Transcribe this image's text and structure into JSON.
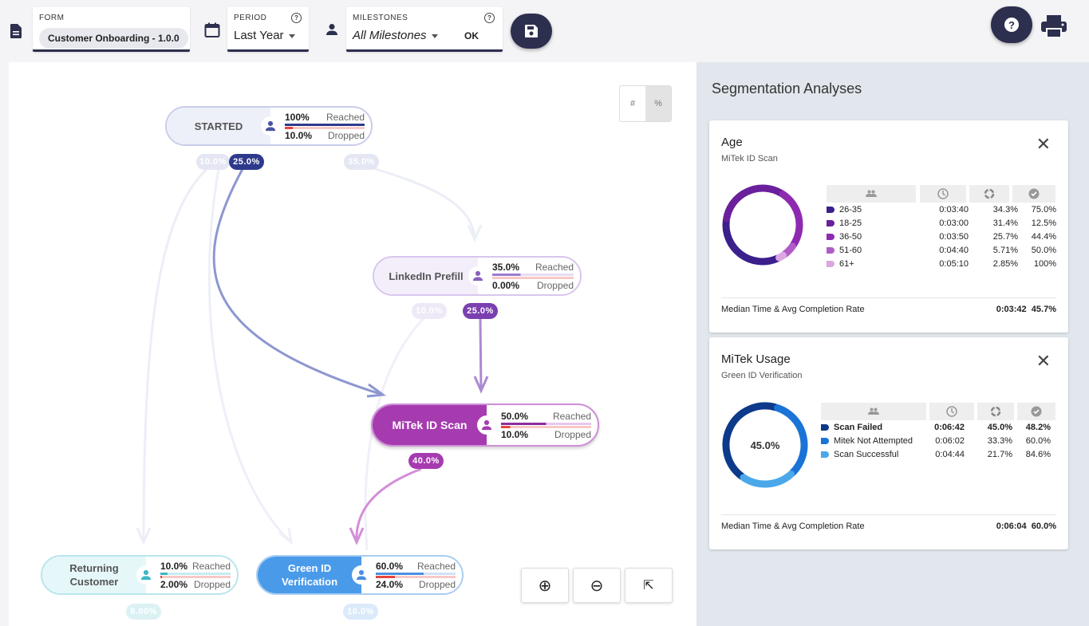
{
  "toolbar": {
    "form_label": "FORM",
    "form_value": "Customer Onboarding - 1.0.0",
    "period_label": "PERIOD",
    "period_value": "Last Year",
    "milestones_label": "MILESTONES",
    "milestones_value": "All Milestones",
    "ok_label": "OK",
    "help_glyph": "?",
    "icons": [
      "document-icon",
      "calendar-icon",
      "person-icon",
      "save-icon",
      "help-icon",
      "print-icon"
    ]
  },
  "view_toggle": {
    "count": "#",
    "percent": "%",
    "selected": "percent"
  },
  "funnel": {
    "nodes": {
      "started": {
        "label": "STARTED",
        "reached": "100%",
        "dropped": "10.0%",
        "reached_label": "Reached",
        "dropped_label": "Dropped",
        "reached_frac": 1.0,
        "dropped_frac": 0.1
      },
      "linkedin": {
        "label": "LinkedIn Prefill",
        "reached": "35.0%",
        "dropped": "0.00%",
        "reached_label": "Reached",
        "dropped_label": "Dropped",
        "reached_frac": 0.35,
        "dropped_frac": 0.0
      },
      "mitek": {
        "label": "MiTek ID Scan",
        "reached": "50.0%",
        "dropped": "10.0%",
        "reached_label": "Reached",
        "dropped_label": "Dropped",
        "reached_frac": 0.5,
        "dropped_frac": 0.1
      },
      "returning": {
        "label": "Returning Customer",
        "reached": "10.0%",
        "dropped": "2.00%",
        "reached_label": "Reached",
        "dropped_label": "Dropped",
        "reached_frac": 0.1,
        "dropped_frac": 0.02
      },
      "greenid": {
        "label": "Green ID Verification",
        "reached": "60.0%",
        "dropped": "24.0%",
        "reached_label": "Reached",
        "dropped_label": "Dropped",
        "reached_frac": 0.6,
        "dropped_frac": 0.24
      }
    },
    "edges": {
      "started_returning": "10.0%",
      "started_mitek": "25.0%",
      "started_linkedin": "35.0%",
      "linkedin_greenid": "10.0%",
      "linkedin_mitek": "25.0%",
      "mitek_greenid": "40.0%",
      "returning_out": "8.00%",
      "greenid_out": "10.0%"
    },
    "colors": {
      "started": "#2d3a8c",
      "linkedin": "#7b3fb0",
      "mitek": "#a63bb0",
      "returning": "#3cb7c4",
      "greenid": "#4a8fe0",
      "dropped": "#e8453c"
    }
  },
  "zoom": {
    "in": "⊕",
    "out": "⊖",
    "reset": "⇱"
  },
  "sidebar": {
    "title": "Segmentation Analyses",
    "cards": [
      {
        "title": "Age",
        "subtitle": "MiTek ID Scan",
        "close": "✕",
        "rows": [
          {
            "label": "26-35",
            "time": "0:03:40",
            "share": "34.3%",
            "rate": "75.0%",
            "color": "#3b1f8c",
            "value": 34.3,
            "bold": false
          },
          {
            "label": "18-25",
            "time": "0:03:00",
            "share": "31.4%",
            "rate": "12.5%",
            "color": "#6a1f9c",
            "value": 31.4,
            "bold": false
          },
          {
            "label": "36-50",
            "time": "0:03:50",
            "share": "25.7%",
            "rate": "44.4%",
            "color": "#8e2ab0",
            "value": 25.7,
            "bold": false
          },
          {
            "label": "51-60",
            "time": "0:04:40",
            "share": "5.71%",
            "rate": "50.0%",
            "color": "#b05cc6",
            "value": 5.71,
            "bold": false
          },
          {
            "label": "61+",
            "time": "0:05:10",
            "share": "2.85%",
            "rate": "100%",
            "color": "#dca6e3",
            "value": 2.85,
            "bold": false
          }
        ],
        "center": "",
        "footer_label": "Median Time & Avg Completion Rate",
        "footer_time": "0:03:42",
        "footer_rate": "45.7%"
      },
      {
        "title": "MiTek Usage",
        "subtitle": "Green ID Verification",
        "close": "✕",
        "rows": [
          {
            "label": "Scan Failed",
            "time": "0:06:42",
            "share": "45.0%",
            "rate": "48.2%",
            "color": "#0d3a8a",
            "value": 45.0,
            "bold": true
          },
          {
            "label": "Mitek Not Attempted",
            "time": "0:06:02",
            "share": "33.3%",
            "rate": "60.0%",
            "color": "#1a73d6",
            "value": 33.3,
            "bold": false
          },
          {
            "label": "Scan Successful",
            "time": "0:04:44",
            "share": "21.7%",
            "rate": "84.6%",
            "color": "#4aa8ea",
            "value": 21.7,
            "bold": false
          }
        ],
        "center": "45.0%",
        "footer_label": "Median Time & Avg Completion Rate",
        "footer_time": "0:06:04",
        "footer_rate": "60.0%"
      }
    ]
  }
}
